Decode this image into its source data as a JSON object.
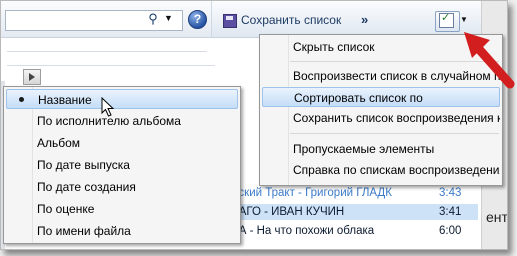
{
  "toolbar": {
    "save_list_label": "Сохранить список",
    "more_label": "»",
    "help_label": "?"
  },
  "list_menu": {
    "items": [
      {
        "label": "Скрыть список"
      },
      {
        "label": "Воспроизвести список в случайном поряд"
      },
      {
        "label": "Сортировать список по",
        "highlighted": true
      },
      {
        "label": "Сохранить список воспроизведения как..."
      },
      {
        "label": "Пропускаемые элементы"
      },
      {
        "label": "Справка по спискам воспроизведения..."
      }
    ]
  },
  "sort_menu": {
    "items": [
      {
        "label": "Название",
        "selected": true,
        "highlighted": true
      },
      {
        "label": "По исполнителю альбома"
      },
      {
        "label": "Альбом"
      },
      {
        "label": "По дате выпуска"
      },
      {
        "label": "По дате создания"
      },
      {
        "label": "По оценке"
      },
      {
        "label": "По имени файла"
      }
    ]
  },
  "tracks": [
    {
      "title": "йский Тракт - Григорий ГЛАДК",
      "duration": "3:43",
      "state": "playing"
    },
    {
      "title": "КАГО - ИВАН КУЧИН",
      "duration": "3:41",
      "state": "selected"
    },
    {
      "title": "КА - На что похожи облака",
      "duration": "6:00",
      "state": "normal"
    }
  ],
  "cut_text": "ента",
  "colors": {
    "accent_arrow": "#d21e1e",
    "highlight": "#c4ddf7",
    "playing_text": "#3b7bc8"
  },
  "icons": [
    "search-icon",
    "help-icon",
    "save-icon",
    "chevron-right-icon",
    "list-options-icon",
    "play-icon",
    "mouse-cursor-icon",
    "red-arrow-icon"
  ]
}
